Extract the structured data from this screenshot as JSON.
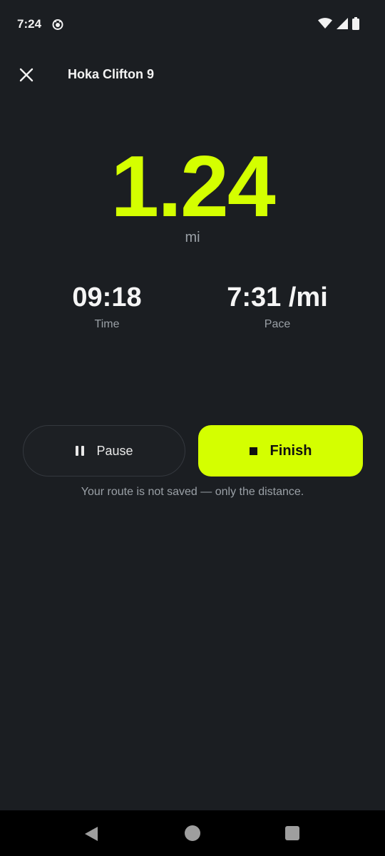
{
  "status_bar": {
    "time": "7:24",
    "icons": [
      "app-notification-icon",
      "wifi-icon",
      "cellular-icon",
      "battery-icon"
    ]
  },
  "header": {
    "close_icon": "close-icon",
    "title": "Hoka Clifton 9"
  },
  "distance": {
    "value": "1.24",
    "unit": "mi"
  },
  "stats": [
    {
      "value": "09:18",
      "label": "Time"
    },
    {
      "value": "7:31 /mi",
      "label": "Pace"
    }
  ],
  "actions": {
    "pause_label": "Pause",
    "pause_icon": "pause-icon",
    "finish_label": "Finish",
    "finish_icon": "stop-icon"
  },
  "note": "Your route is not saved — only the distance.",
  "nav_bar": {
    "icons": [
      "back-icon",
      "home-icon",
      "recents-icon"
    ]
  },
  "colors": {
    "background": "#1b1e22",
    "accent": "#d4ff00",
    "muted_text": "#9aa0a6"
  }
}
